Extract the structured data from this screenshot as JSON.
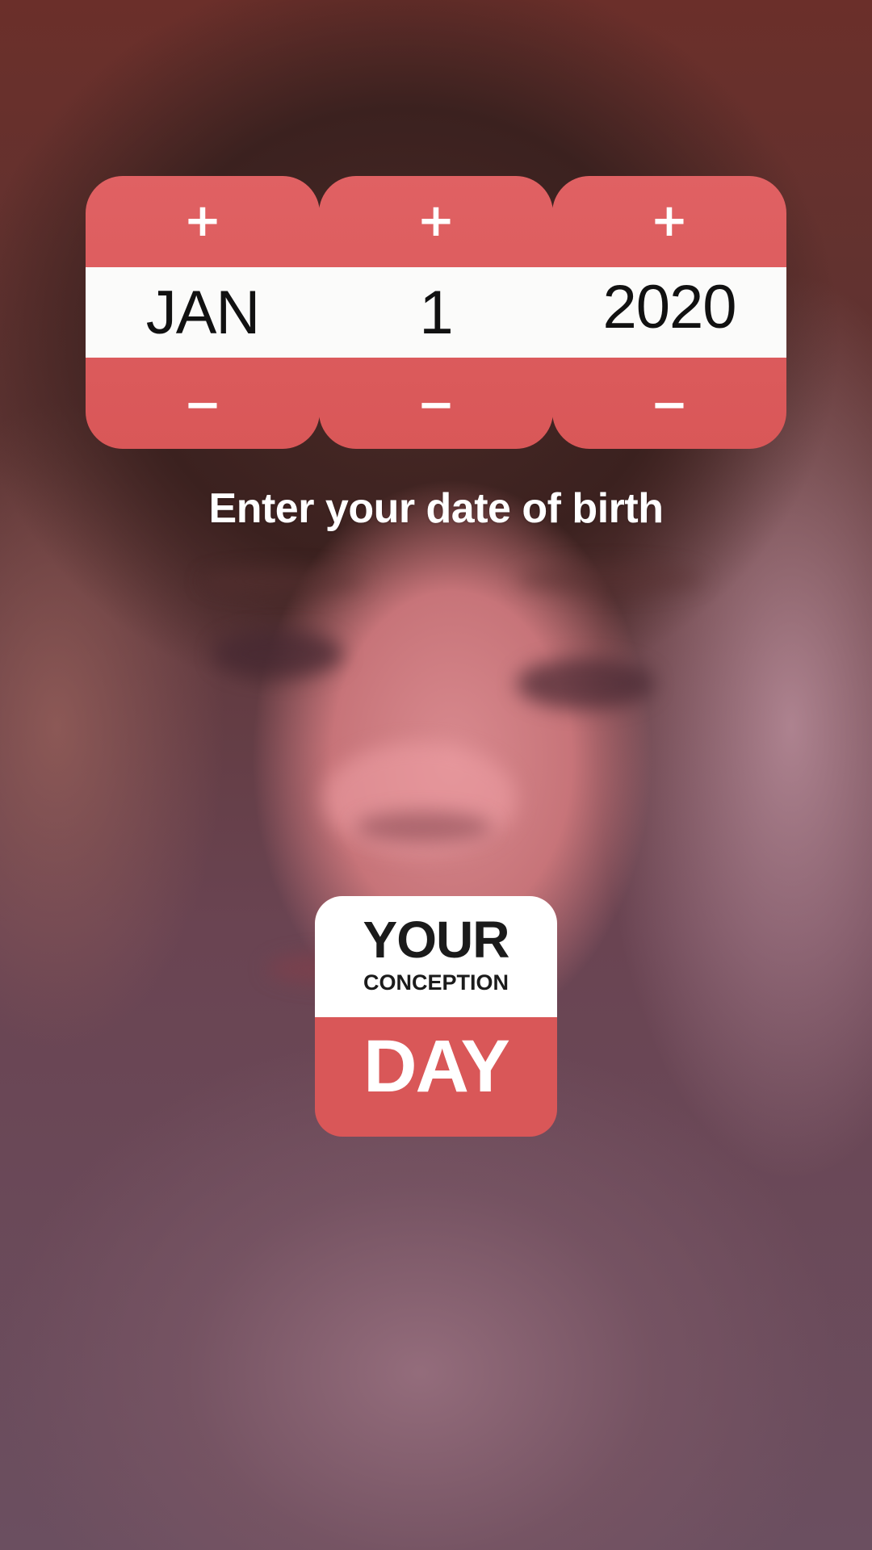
{
  "date_picker": {
    "increment_symbol": "+",
    "decrement_symbol": "−",
    "month": "JAN",
    "day": "1",
    "year": "2020"
  },
  "prompt": "Enter your date of birth",
  "badge": {
    "line1": "YOUR",
    "line2": "CONCEPTION",
    "line3": "DAY"
  },
  "colors": {
    "accent": "#d95758",
    "band": "#fbfbfa",
    "text_dark": "#111111"
  }
}
